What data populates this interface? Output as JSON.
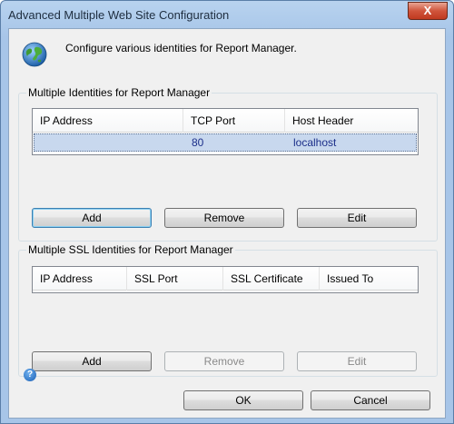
{
  "window": {
    "title": "Advanced Multiple Web Site Configuration",
    "close_glyph": "X"
  },
  "header": {
    "description": "Configure various identities for Report Manager.",
    "icon": "globe-icon"
  },
  "identities": {
    "group_label": "Multiple Identities for Report Manager",
    "columns": [
      "IP Address",
      "TCP Port",
      "Host Header"
    ],
    "rows": [
      {
        "ip_address": "",
        "tcp_port": "80",
        "host_header": "localhost"
      }
    ],
    "buttons": {
      "add": "Add",
      "remove": "Remove",
      "edit": "Edit"
    }
  },
  "ssl_identities": {
    "group_label": "Multiple SSL Identities for Report Manager",
    "columns": [
      "IP Address",
      "SSL Port",
      "SSL Certificate",
      "Issued To"
    ],
    "rows": [],
    "buttons": {
      "add": "Add",
      "remove": "Remove",
      "edit": "Edit"
    }
  },
  "footer": {
    "help_glyph": "?",
    "ok": "OK",
    "cancel": "Cancel"
  },
  "colors": {
    "selected_row": "#c8d8ee",
    "row_text": "#1c2f8a",
    "close_button": "#c0391f"
  }
}
